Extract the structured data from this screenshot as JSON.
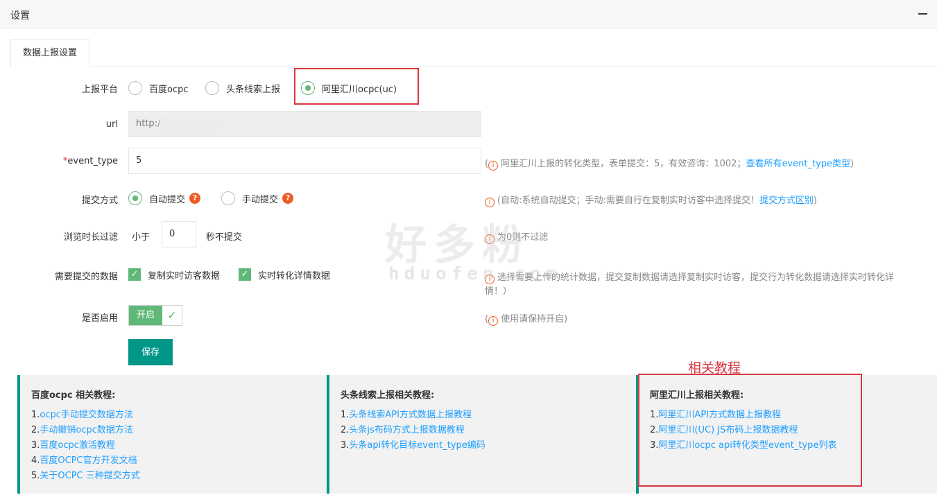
{
  "window": {
    "title": "设置"
  },
  "tabs": [
    {
      "label": "数据上报设置"
    }
  ],
  "form": {
    "platform": {
      "label": "上报平台",
      "options": [
        "百度ocpc",
        "头条线索上报",
        "阿里汇川ocpc(uc)"
      ],
      "selected": "阿里汇川ocpc(uc)"
    },
    "url": {
      "label": "url",
      "value": "http:/"
    },
    "event_type": {
      "required_mark": "*",
      "label": "event_type",
      "value": "5",
      "tip_open": "(",
      "tip": "阿里汇川上报的转化类型，表单提交：5，有效咨询：1002；",
      "tip_link": "查看所有event_type类型",
      "tip_close": ")"
    },
    "submit_mode": {
      "label": "提交方式",
      "options": [
        "自动提交",
        "手动提交"
      ],
      "selected": "自动提交",
      "help_glyph": "?",
      "tip": "(自动:系统自动提交；手动:需要自行在复制实时访客中选择提交！",
      "tip_link": "提交方式区别",
      "tip_close": ")"
    },
    "duration_filter": {
      "label": "浏览时长过滤",
      "prefix": "小于",
      "value": "0",
      "suffix": "秒不提交",
      "tip": "为0则不过滤"
    },
    "data_to_submit": {
      "label": "需要提交的数据",
      "options": [
        "复制实时访客数据",
        "实时转化详情数据"
      ],
      "tip_line1": "选择需要上传的统计数据，提交复制数据请选择复制实时访客，提交行为转化数据请选择实时转化详",
      "tip_line2": "情！）"
    },
    "enabled": {
      "label": "是否启用",
      "switch_text": "开启",
      "tip_open": "(",
      "tip": "使用请保持开启)"
    },
    "save_label": "保存"
  },
  "watermark": {
    "text": "好多粉",
    "domain": "hduofen.com"
  },
  "related_label": "相关教程",
  "tutorials": [
    {
      "title": "百度ocpc 相关教程:",
      "items": [
        {
          "num": "1.",
          "text": "ocpc手动提交数据方法"
        },
        {
          "num": "2.",
          "text": "手动撤销ocpc数据方法"
        },
        {
          "num": "3.",
          "text": "百度ocpc激活教程"
        },
        {
          "num": "4.",
          "text": "百度OCPC官方开发文档"
        },
        {
          "num": "5.",
          "text": "关于OCPC 三种提交方式"
        }
      ]
    },
    {
      "title": "头条线索上报相关教程:",
      "items": [
        {
          "num": "1.",
          "text": "头条线索API方式数据上报教程"
        },
        {
          "num": "2.",
          "text": "头条js布码方式上报数据教程"
        },
        {
          "num": "3.",
          "text": "头条api转化目标event_type编码"
        }
      ]
    },
    {
      "title": "阿里汇川上报相关教程:",
      "items": [
        {
          "num": "1.",
          "text": "阿里汇川API方式数据上报教程"
        },
        {
          "num": "2.",
          "text": "阿里汇川(UC) JS布码上报数据教程"
        },
        {
          "num": "3.",
          "text": "阿里汇川ocpc api转化类型event_type列表"
        }
      ]
    }
  ],
  "colors": {
    "accent": "#009688",
    "green": "#5fb878",
    "link": "#1e9fff",
    "highlight_red": "#d9363e",
    "warn": "#f15a22"
  }
}
